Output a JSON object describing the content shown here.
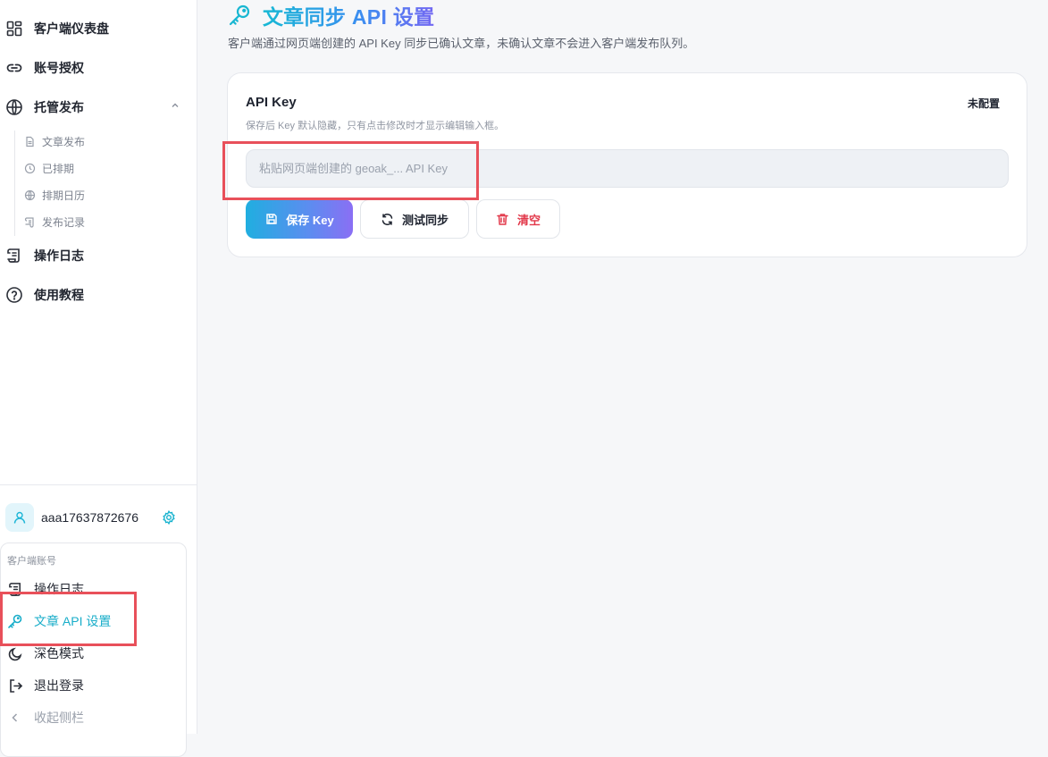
{
  "sidebar": {
    "nav": [
      {
        "label": "客户端仪表盘",
        "icon": "dashboard-grid-icon"
      },
      {
        "label": "账号授权",
        "icon": "link-icon"
      },
      {
        "label": "托管发布",
        "icon": "globe-icon",
        "expanded": true
      },
      {
        "label": "操作日志",
        "icon": "scroll-icon"
      },
      {
        "label": "使用教程",
        "icon": "help-circle-icon"
      }
    ],
    "sub_items": [
      {
        "label": "文章发布",
        "icon": "document-icon"
      },
      {
        "label": "已排期",
        "icon": "clock-icon"
      },
      {
        "label": "排期日历",
        "icon": "globe-icon"
      },
      {
        "label": "发布记录",
        "icon": "scroll-icon"
      }
    ],
    "user": {
      "name": "aaa17637872676"
    },
    "account_menu": {
      "header": "客户端账号",
      "items": [
        {
          "label": "操作日志",
          "icon": "scroll-icon"
        },
        {
          "label": "文章 API 设置",
          "icon": "key-icon",
          "active": true
        },
        {
          "label": "深色模式",
          "icon": "moon-icon"
        },
        {
          "label": "退出登录",
          "icon": "logout-icon"
        },
        {
          "label": "收起侧栏",
          "icon": "chevron-left-icon"
        }
      ]
    }
  },
  "main": {
    "title": "文章同步 API 设置",
    "subtitle": "客户端通过网页端创建的 API Key 同步已确认文章，未确认文章不会进入客户端发布队列。",
    "card": {
      "title": "API Key",
      "status": "未配置",
      "hint": "保存后 Key 默认隐藏，只有点击修改时才显示编辑输入框。",
      "input_placeholder": "粘贴网页端创建的 geoak_... API Key",
      "input_value": "",
      "buttons": {
        "save": "保存 Key",
        "test": "测试同步",
        "clear": "清空"
      }
    }
  },
  "colors": {
    "accent": "#18adc9",
    "danger": "#e2384a",
    "annotation": "#e8505a"
  }
}
